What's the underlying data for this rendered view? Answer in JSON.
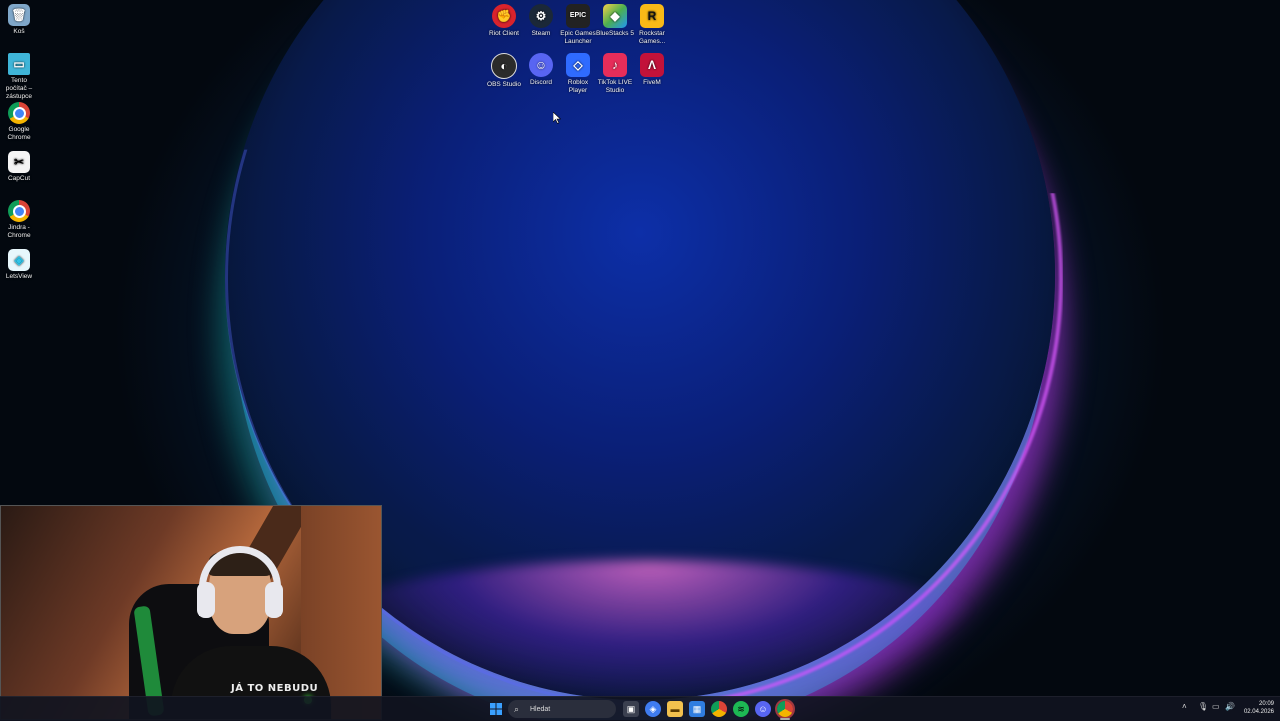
{
  "desktop_icons_left": [
    {
      "label": "Koš",
      "icon": "recycle-bin-icon",
      "color": "#7fa7c9"
    },
    {
      "label": "Tento počítač – zástupce",
      "icon": "this-pc-icon",
      "color": "#3fb5d8"
    },
    {
      "label": "Google Chrome",
      "icon": "chrome-icon",
      "color": "#e0402f"
    },
    {
      "label": "CapCut",
      "icon": "capcut-icon",
      "color": "#f5f5f5"
    },
    {
      "label": "Jindra - Chrome",
      "icon": "chrome-profile-icon",
      "color": "#e0402f"
    },
    {
      "label": "LetsView",
      "icon": "letsview-icon",
      "color": "#2ec4e8"
    }
  ],
  "desktop_icons_top": [
    {
      "label": "Riot Client",
      "icon": "riot-client-icon",
      "color": "#d9232c",
      "glyph": "✊"
    },
    {
      "label": "Steam",
      "icon": "steam-icon",
      "color": "#1b2838",
      "glyph": "⚙"
    },
    {
      "label": "Epic Games Launcher",
      "icon": "epic-games-icon",
      "color": "#222222",
      "glyph": "EPIC"
    },
    {
      "label": "BlueStacks 5",
      "icon": "bluestacks-icon",
      "color": "#4caf50",
      "glyph": "◆"
    },
    {
      "label": "Rockstar Games...",
      "icon": "rockstar-icon",
      "color": "#f9b917",
      "glyph": "R"
    },
    {
      "label": "OBS Studio",
      "icon": "obs-icon",
      "color": "#2b2b2b",
      "glyph": "◐"
    },
    {
      "label": "Discord",
      "icon": "discord-icon",
      "color": "#5865f2",
      "glyph": "☺"
    },
    {
      "label": "Roblox Player",
      "icon": "roblox-icon",
      "color": "#2f6bff",
      "glyph": "◇"
    },
    {
      "label": "TikTok LIVE Studio",
      "icon": "tiktok-live-icon",
      "color": "#e62d5a",
      "glyph": "♪"
    },
    {
      "label": "FiveM",
      "icon": "fivem-icon",
      "color": "#c2123a",
      "glyph": "Λ"
    }
  ],
  "webcam": {
    "shirt_text": "JÁ TO NEBUDU"
  },
  "taskbar": {
    "search_placeholder": "Hledat",
    "apps": [
      {
        "icon": "task-view-icon",
        "color": "#3a3f4f",
        "glyph": "▣"
      },
      {
        "icon": "copilot-icon",
        "color": "#3f7cf0",
        "glyph": "◈"
      },
      {
        "icon": "file-explorer-icon",
        "color": "#f2c14e",
        "glyph": "▬"
      },
      {
        "icon": "microsoft-store-icon",
        "color": "#2f7de1",
        "glyph": "▦"
      },
      {
        "icon": "chrome-taskbar-icon",
        "color": "#e0402f",
        "glyph": "◉"
      },
      {
        "icon": "spotify-icon",
        "color": "#1db954",
        "glyph": "≋"
      },
      {
        "icon": "discord-taskbar-icon",
        "color": "#5865f2",
        "glyph": "☺"
      },
      {
        "icon": "chrome-profile-taskbar-icon",
        "color": "#d93025",
        "glyph": "◉"
      }
    ],
    "time": "20:09",
    "date": "02.04.2026"
  }
}
